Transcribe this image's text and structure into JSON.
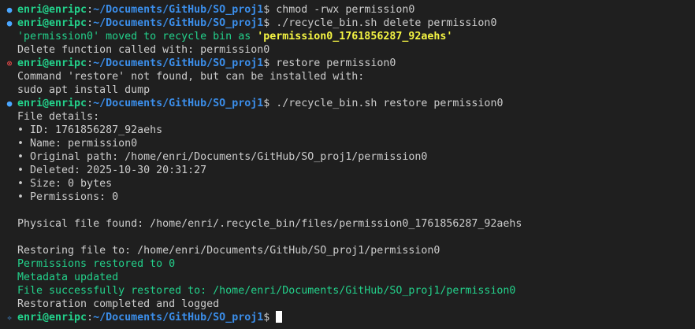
{
  "prompt": {
    "user": "enri@enripc",
    "path": "~/Documents/GitHub/SO_proj1",
    "symbol": "$"
  },
  "lines": [
    {
      "cmd": " chmod -rwx permission0"
    },
    {
      "cmd": " ./recycle_bin.sh delete permission0"
    },
    {
      "a": "'permission0' moved to recycle bin as ",
      "b": "'permission0_1761856287_92aehs'"
    },
    {
      "text": "Delete function called with: permission0"
    },
    {
      "cmd": " restore permission0"
    },
    {
      "text": "Command 'restore' not found, but can be installed with:"
    },
    {
      "text": "sudo apt install dump"
    },
    {
      "cmd": " ./recycle_bin.sh restore permission0"
    },
    {
      "text": "File details:"
    },
    {
      "text": "• ID: 1761856287_92aehs"
    },
    {
      "text": "• Name: permission0"
    },
    {
      "text": "• Original path: /home/enri/Documents/GitHub/SO_proj1/permission0"
    },
    {
      "text": "• Deleted: 2025-10-30 20:31:27"
    },
    {
      "text": "• Size: 0 bytes"
    },
    {
      "text": "• Permissions: 0"
    },
    {
      "text": "Physical file found: /home/enri/.recycle_bin/files/permission0_1761856287_92aehs"
    },
    {
      "text": "Restoring file to: /home/enri/Documents/GitHub/SO_proj1/permission0"
    },
    {
      "text": "Permissions restored to 0"
    },
    {
      "text": "Metadata updated"
    },
    {
      "text": "File successfully restored to: /home/enri/Documents/GitHub/SO_proj1/permission0"
    },
    {
      "text": "Restoration completed and logged"
    }
  ],
  "icons": {
    "success": "●",
    "error": "⊗",
    "sparkle": "✧"
  },
  "colors": {
    "background": "#1f1f1f",
    "user": "#23d18b",
    "path": "#3b8eea",
    "success_text": "#23d18b",
    "highlight": "#f5f543",
    "error_marker": "#f14c4c"
  }
}
